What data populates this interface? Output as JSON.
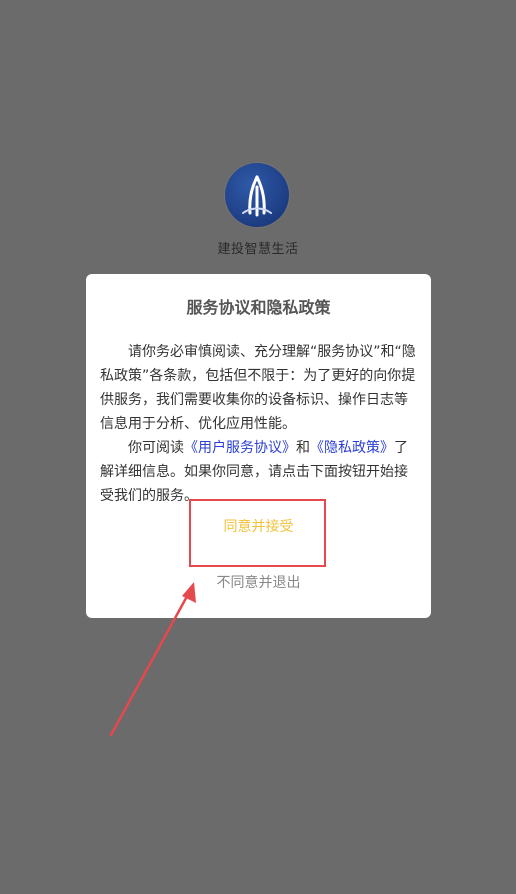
{
  "app": {
    "name": "建投智慧生活",
    "logo_icon": "circle-emblem-icon"
  },
  "dialog": {
    "title": "服务协议和隐私政策",
    "para1": "请你务必审慎阅读、充分理解“服务协议”和“隐私政策”各条款，包括但不限于：为了更好的向你提供服务，我们需要收集你的设备标识、操作日志等信息用于分析、优化应用性能。",
    "para2_prefix": "你可阅读",
    "link_user_agreement": "《用户服务协议》",
    "para2_and": "和",
    "link_privacy_policy": "《隐私政策》",
    "para2_suffix": "了解详细信息。如果你同意，请点击下面按钮开始接受我们的服务。",
    "accept_label": "同意并接受",
    "decline_label": "不同意并退出"
  },
  "colors": {
    "overlay": "#6b6b6b",
    "accept": "#f1c23a",
    "link": "#2b3fd6",
    "annotation": "#e5484d"
  }
}
